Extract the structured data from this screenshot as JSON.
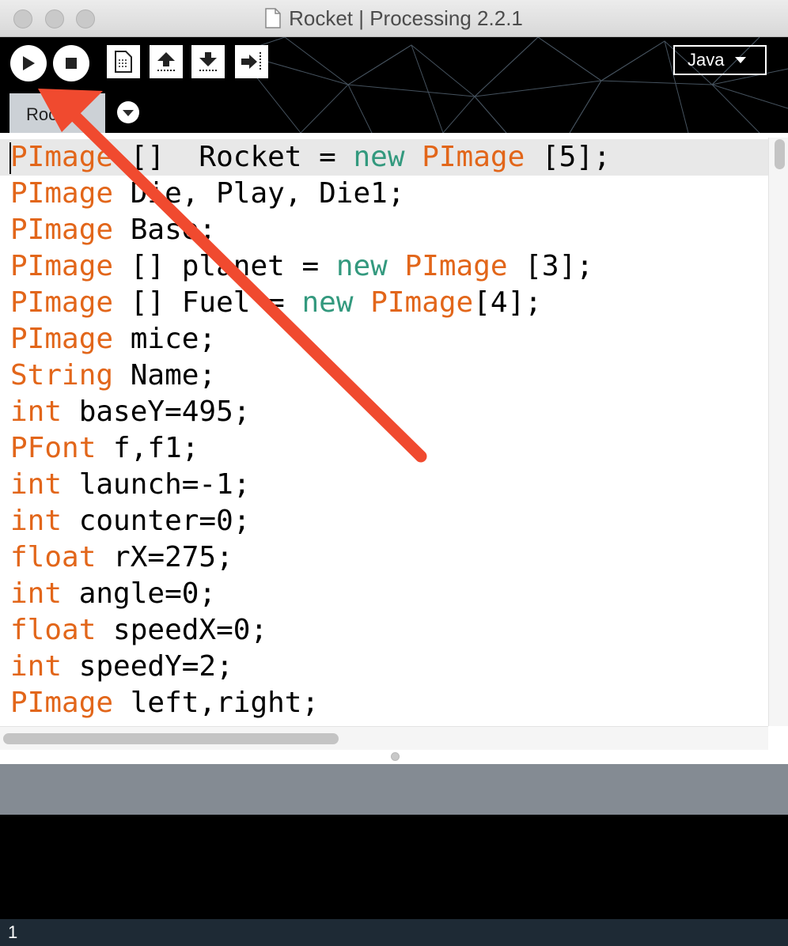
{
  "window": {
    "title": "Rocket | Processing 2.2.1"
  },
  "toolbar": {
    "buttons": [
      {
        "name": "run",
        "icon": "play-icon"
      },
      {
        "name": "stop",
        "icon": "stop-icon"
      },
      {
        "name": "new",
        "icon": "new-document-icon"
      },
      {
        "name": "open",
        "icon": "upload-arrow-icon"
      },
      {
        "name": "save",
        "icon": "download-arrow-icon"
      },
      {
        "name": "export",
        "icon": "export-arrow-icon"
      }
    ],
    "mode_label": "Java"
  },
  "tabs": [
    {
      "label": "Rocket"
    }
  ],
  "editor": {
    "lines": [
      [
        {
          "t": "PImage",
          "c": "kw"
        },
        {
          "t": " []  Rocket = "
        },
        {
          "t": "new",
          "c": "kw2"
        },
        {
          "t": " "
        },
        {
          "t": "PImage",
          "c": "kw"
        },
        {
          "t": " [5];"
        }
      ],
      [
        {
          "t": "PImage",
          "c": "kw"
        },
        {
          "t": " Die, Play, Die1;"
        }
      ],
      [
        {
          "t": "PImage",
          "c": "kw"
        },
        {
          "t": " Base;"
        }
      ],
      [
        {
          "t": "PImage",
          "c": "kw"
        },
        {
          "t": " [] planet = "
        },
        {
          "t": "new",
          "c": "kw2"
        },
        {
          "t": " "
        },
        {
          "t": "PImage",
          "c": "kw"
        },
        {
          "t": " [3];"
        }
      ],
      [
        {
          "t": "PImage",
          "c": "kw"
        },
        {
          "t": " [] Fuel = "
        },
        {
          "t": "new",
          "c": "kw2"
        },
        {
          "t": " "
        },
        {
          "t": "PImage",
          "c": "kw"
        },
        {
          "t": "[4];"
        }
      ],
      [
        {
          "t": "PImage",
          "c": "kw"
        },
        {
          "t": " mice;"
        }
      ],
      [
        {
          "t": "String",
          "c": "kw"
        },
        {
          "t": " Name;"
        }
      ],
      [
        {
          "t": "int",
          "c": "kw"
        },
        {
          "t": " baseY=495;"
        }
      ],
      [
        {
          "t": "PFont",
          "c": "kw"
        },
        {
          "t": " f,f1;"
        }
      ],
      [
        {
          "t": "int",
          "c": "kw"
        },
        {
          "t": " launch=-1;"
        }
      ],
      [
        {
          "t": "int",
          "c": "kw"
        },
        {
          "t": " counter=0;"
        }
      ],
      [
        {
          "t": "float",
          "c": "kw"
        },
        {
          "t": " rX=275;"
        }
      ],
      [
        {
          "t": "int",
          "c": "kw"
        },
        {
          "t": " angle=0;"
        }
      ],
      [
        {
          "t": "float",
          "c": "kw"
        },
        {
          "t": " speedX=0;"
        }
      ],
      [
        {
          "t": "int",
          "c": "kw"
        },
        {
          "t": " speedY=2;"
        }
      ],
      [
        {
          "t": "PImage",
          "c": "kw"
        },
        {
          "t": " left,right;"
        }
      ]
    ]
  },
  "status": {
    "line_number": "1"
  },
  "colors": {
    "keyword": "#e2661a",
    "keyword2": "#33997e",
    "annotation_arrow": "#f04a2f"
  }
}
